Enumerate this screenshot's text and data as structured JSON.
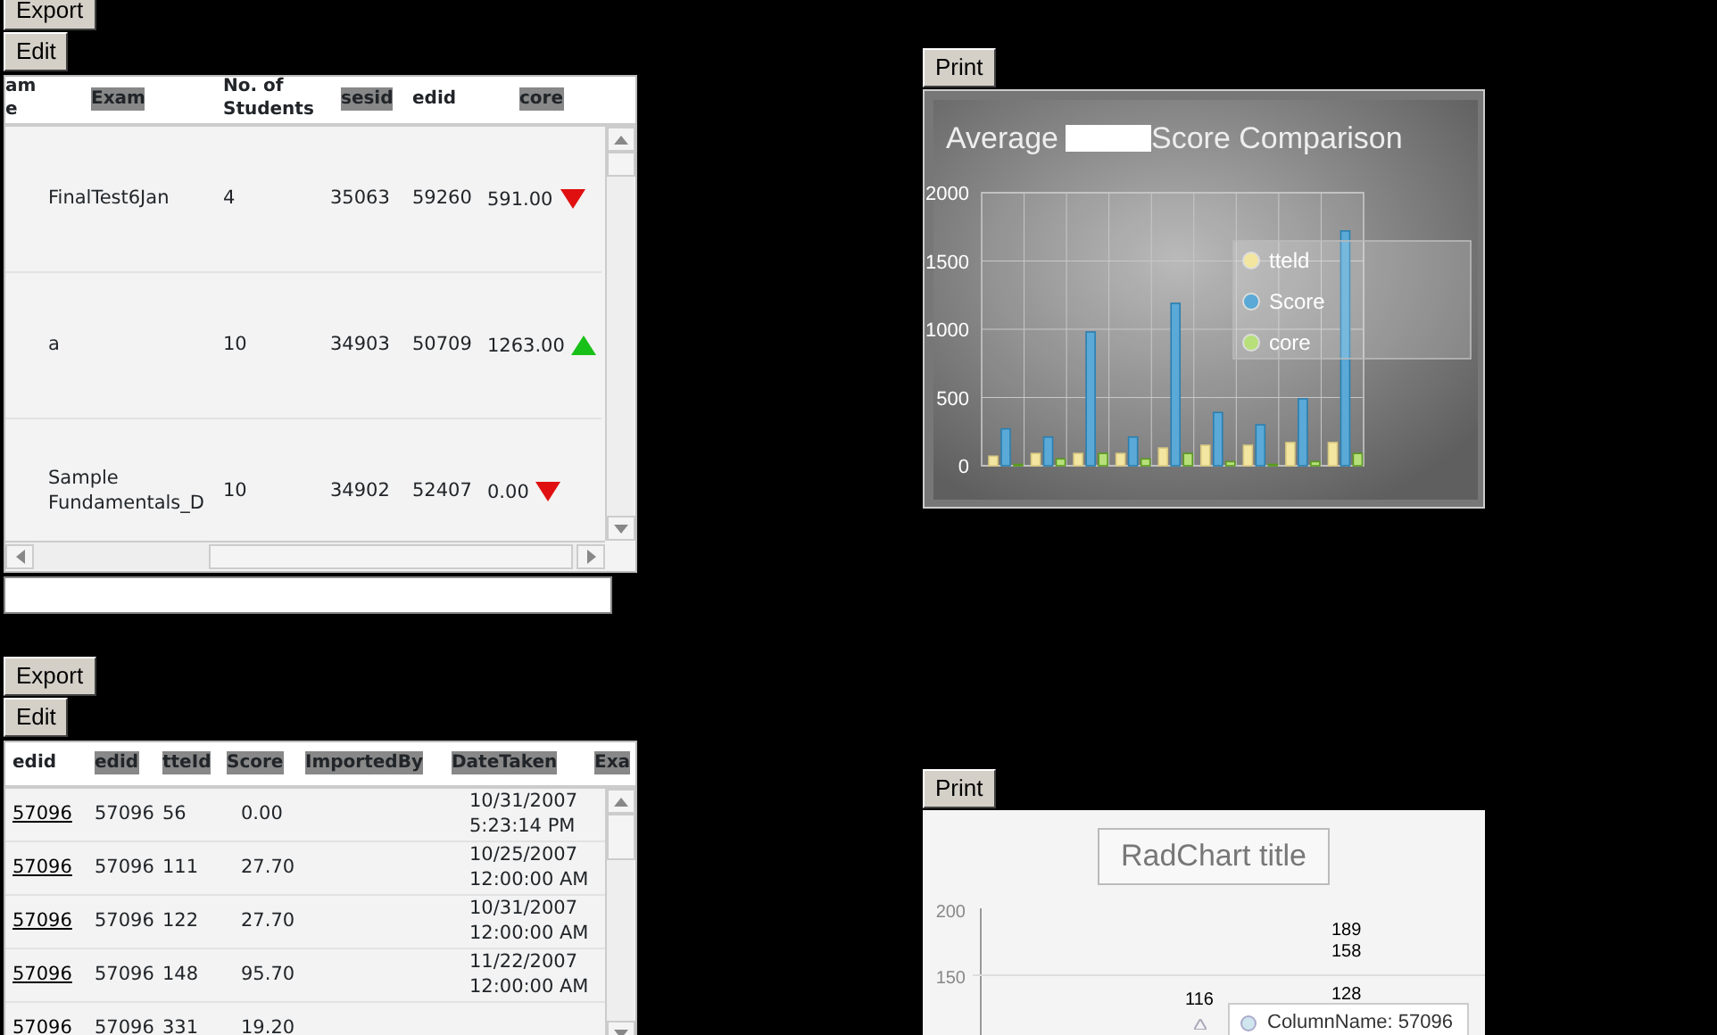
{
  "exam_panel": {
    "buttons": [
      "Export",
      "Edit"
    ],
    "columns": [
      {
        "label": "am\ne",
        "highlighted": false
      },
      {
        "label": "Exam",
        "highlighted": true
      },
      {
        "label": "No. of\nStudents",
        "highlighted": false
      },
      {
        "label": "sesid",
        "highlighted": true
      },
      {
        "label": "edid",
        "highlighted": false
      },
      {
        "label": "core",
        "highlighted": true
      }
    ],
    "rows": [
      {
        "exam": "FinalTest6Jan",
        "students": "4",
        "sesid": "35063",
        "edid": "59260",
        "score": "591.00",
        "rising": false
      },
      {
        "exam": "a",
        "students": "10",
        "sesid": "34903",
        "edid": "50709",
        "score": "1263.00",
        "rising": true
      },
      {
        "exam": "Sample\nFundamentals_D",
        "students": "10",
        "sesid": "34902",
        "edid": "52407",
        "score": "0.00",
        "rising": false
      }
    ]
  },
  "score_panel": {
    "buttons": [
      "Export",
      "Edit"
    ],
    "columns": [
      {
        "label": "edid",
        "highlighted": false
      },
      {
        "label": "edid",
        "highlighted": true
      },
      {
        "label": "tteId",
        "highlighted": true
      },
      {
        "label": "Score",
        "highlighted": true
      },
      {
        "label": "ImportedBy",
        "highlighted": true
      },
      {
        "label": "DateTaken",
        "highlighted": true
      },
      {
        "label": "Exa",
        "highlighted": true
      }
    ],
    "rows": [
      {
        "link": "57096",
        "edid": "57096",
        "tteid": "56",
        "score": "0.00",
        "date": "10/31/2007\n5:23:14 PM"
      },
      {
        "link": "57096",
        "edid": "57096",
        "tteid": "111",
        "score": "27.70",
        "date": "10/25/2007\n12:00:00 AM"
      },
      {
        "link": "57096",
        "edid": "57096",
        "tteid": "122",
        "score": "27.70",
        "date": "10/31/2007\n12:00:00 AM"
      },
      {
        "link": "57096",
        "edid": "57096",
        "tteid": "148",
        "score": "95.70",
        "date": "11/22/2007\n12:00:00 AM"
      },
      {
        "link": "57096",
        "edid": "57096",
        "tteid": "331",
        "score": "19.20"
      }
    ]
  },
  "comparison_panel": {
    "button": "Print",
    "title_start": "Average",
    "title_end": "Score Comparison",
    "chart_data": {
      "type": "bar",
      "grid": true,
      "legend": true,
      "ylim": [
        0,
        2000
      ],
      "yticks": [
        0,
        500,
        1000,
        1500,
        2000
      ],
      "series": [
        {
          "name": "tteld",
          "color": "#f3e6a0",
          "values": [
            70,
            90,
            90,
            90,
            130,
            150,
            150,
            170,
            170
          ]
        },
        {
          "name": "Score",
          "color": "#5aa9d6",
          "values": [
            270,
            210,
            980,
            210,
            1190,
            390,
            300,
            490,
            1720
          ]
        },
        {
          "name": "core",
          "color": "#b8e07a",
          "values": [
            10,
            50,
            90,
            50,
            90,
            30,
            10,
            30,
            90
          ]
        }
      ]
    }
  },
  "radchart_panel": {
    "button": "Print",
    "title": "RadChart title",
    "y_labels": [
      "200",
      "150"
    ],
    "point_labels": [
      "116",
      "189",
      "158",
      "128"
    ],
    "tooltip": "ColumnName: 57096"
  }
}
